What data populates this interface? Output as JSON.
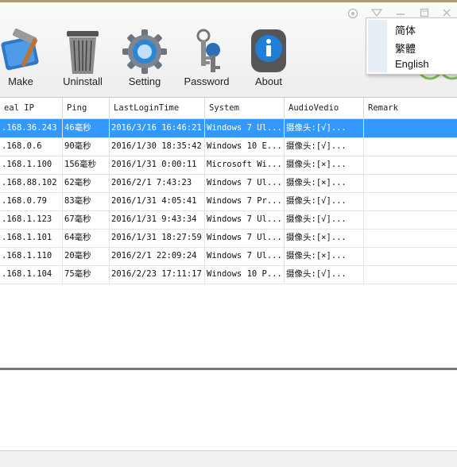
{
  "toolbar": {
    "buttons": [
      {
        "label": "Make",
        "icon": "hammer-icon"
      },
      {
        "label": "Uninstall",
        "icon": "trash-can-icon"
      },
      {
        "label": "Setting",
        "icon": "gear-icon"
      },
      {
        "label": "Password",
        "icon": "keys-icon"
      },
      {
        "label": "About",
        "icon": "info-icon"
      }
    ]
  },
  "language_menu": {
    "items": [
      "简体",
      "繁體",
      "English"
    ]
  },
  "table": {
    "columns": [
      "eal IP",
      "Ping",
      "LastLoginTime",
      "System",
      "AudioVedio",
      "Remark"
    ],
    "rows": [
      {
        "ip": ".168.36.243",
        "ping": "46毫秒",
        "time": "2016/3/16 16:46:21",
        "system": "Windows 7 Ul...",
        "av": "摄像头:[√]...",
        "remark": "",
        "selected": true
      },
      {
        "ip": ".168.0.6",
        "ping": "90毫秒",
        "time": "2016/1/30 18:35:42",
        "system": "Windows 10 E...",
        "av": "摄像头:[√]...",
        "remark": "",
        "selected": false
      },
      {
        "ip": ".168.1.100",
        "ping": "156毫秒",
        "time": "2016/1/31 0:00:11",
        "system": "Microsoft Wi...",
        "av": "摄像头:[×]...",
        "remark": "",
        "selected": false
      },
      {
        "ip": ".168.88.102",
        "ping": "62毫秒",
        "time": "2016/2/1 7:43:23",
        "system": "Windows 7 Ul...",
        "av": "摄像头:[×]...",
        "remark": "",
        "selected": false
      },
      {
        "ip": ".168.0.79",
        "ping": "83毫秒",
        "time": "2016/1/31 4:05:41",
        "system": "Windows 7 Pr...",
        "av": "摄像头:[√]...",
        "remark": "",
        "selected": false
      },
      {
        "ip": ".168.1.123",
        "ping": "67毫秒",
        "time": "2016/1/31 9:43:34",
        "system": "Windows 7 Ul...",
        "av": "摄像头:[√]...",
        "remark": "",
        "selected": false
      },
      {
        "ip": ".168.1.101",
        "ping": "64毫秒",
        "time": "2016/1/31 18:27:59",
        "system": "Windows 7 Ul...",
        "av": "摄像头:[×]...",
        "remark": "",
        "selected": false
      },
      {
        "ip": ".168.1.110",
        "ping": "20毫秒",
        "time": "2016/2/1 22:09:24",
        "system": "Windows 7 Ul...",
        "av": "摄像头:[×]...",
        "remark": "",
        "selected": false
      },
      {
        "ip": ".168.1.104",
        "ping": "75毫秒",
        "time": "2016/2/23 17:11:17",
        "system": "Windows 10 P...",
        "av": "摄像头:[√]...",
        "remark": "",
        "selected": false
      }
    ]
  },
  "colors": {
    "selection": "#3399ff",
    "accent_green": "#7cc04a"
  },
  "window_controls": {
    "icons": [
      "skin-icon",
      "dropdown-triangle-icon",
      "minimize-icon",
      "maximize-icon",
      "close-icon"
    ]
  }
}
